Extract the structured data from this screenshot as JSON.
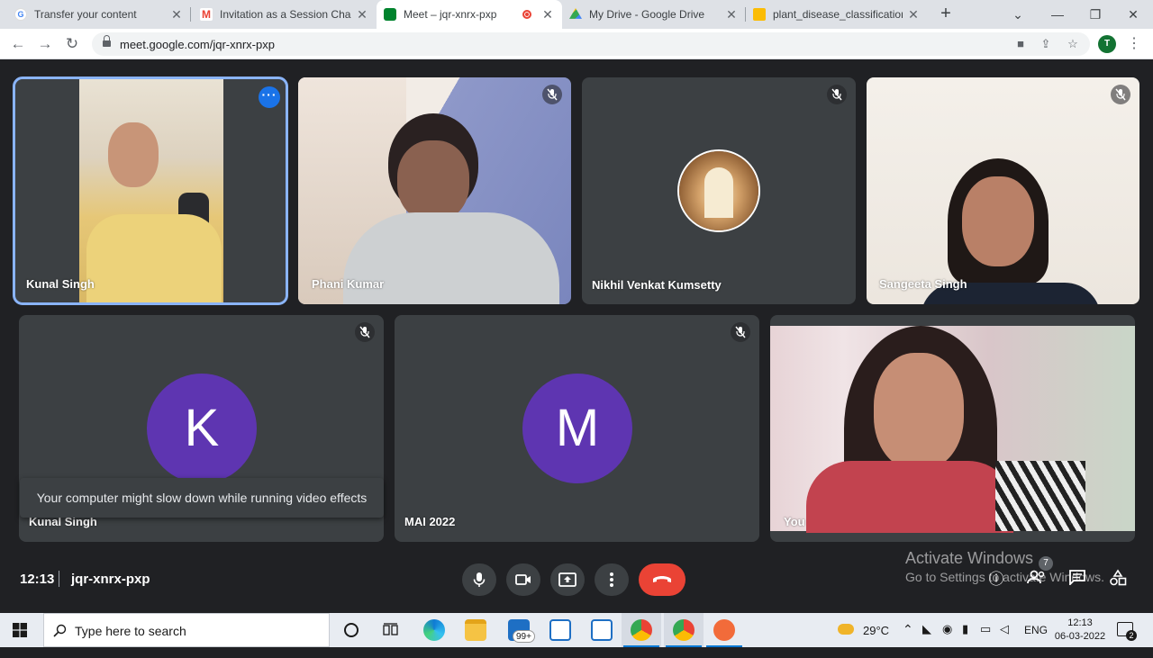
{
  "browser": {
    "tabs": [
      {
        "title": "Transfer your content",
        "icon": "google-icon"
      },
      {
        "title": "Invitation as a Session Chair/",
        "icon": "gmail-icon"
      },
      {
        "title": "Meet – jqr-xnrx-pxp",
        "icon": "meet-icon",
        "active": true
      },
      {
        "title": "My Drive - Google Drive",
        "icon": "drive-icon"
      },
      {
        "title": "plant_disease_classification_",
        "icon": "slides-icon"
      }
    ],
    "url": "meet.google.com/jqr-xnrx-pxp",
    "profile_initial": "T"
  },
  "meet": {
    "participants": [
      {
        "name": "Kunal Singh",
        "type": "video",
        "active_speaker": true
      },
      {
        "name": "Phani Kumar",
        "type": "video",
        "muted": true
      },
      {
        "name": "Nikhil Venkat Kumsetty",
        "type": "photo-avatar",
        "muted": true
      },
      {
        "name": "Sangeeta Singh",
        "type": "video",
        "muted": true
      },
      {
        "name": "Kunal Singh",
        "type": "letter-avatar",
        "letter": "K",
        "muted": true
      },
      {
        "name": "MAI 2022",
        "type": "letter-avatar",
        "letter": "M",
        "muted": true
      },
      {
        "name": "You",
        "type": "video"
      }
    ],
    "toast": "Your computer might slow down while running video effects",
    "time": "12:13",
    "meeting_code": "jqr-xnrx-pxp",
    "participant_count": "7",
    "avatar_color": "#5e35b1",
    "end_call_color": "#ea4335"
  },
  "watermark": {
    "line1": "Activate Windows",
    "line2": "Go to Settings to activate Windows."
  },
  "taskbar": {
    "search_placeholder": "Type here to search",
    "mail_badge": "99+",
    "weather": "29°C",
    "language": "ENG",
    "time": "12:13",
    "date": "06-03-2022",
    "notification_count": "2"
  }
}
